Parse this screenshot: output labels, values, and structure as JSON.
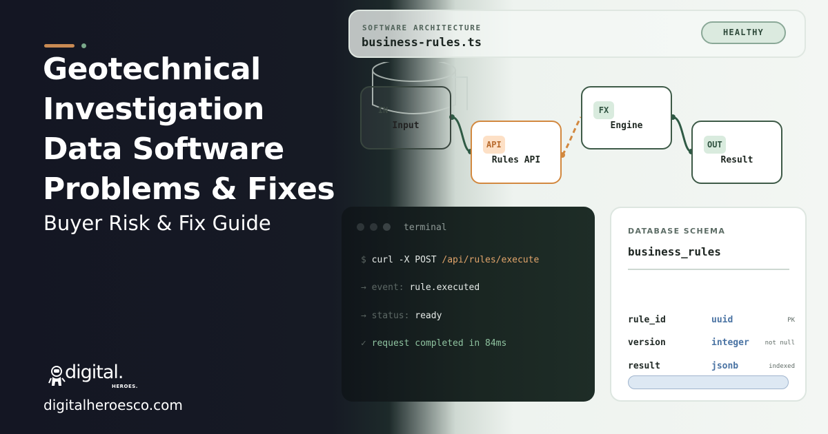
{
  "hero": {
    "title_lines": [
      "Geotechnical",
      "Investigation",
      "Data Software",
      "Problems & Fixes"
    ],
    "subtitle": "Buyer Risk & Fix Guide",
    "accent_color": "#c98a53"
  },
  "brand": {
    "logo_word": "digital.",
    "logo_sub": "HEROES.",
    "url": "digitalheroesco.com"
  },
  "header": {
    "eyebrow": "SOFTWARE ARCHITECTURE",
    "file": "business-rules.ts",
    "status": "HEALTHY"
  },
  "pipeline": {
    "nodes": [
      {
        "tag": "IN",
        "label": "Input"
      },
      {
        "tag": "API",
        "label": "Rules API"
      },
      {
        "tag": "FX",
        "label": "Engine"
      },
      {
        "tag": "OUT",
        "label": "Result"
      }
    ],
    "colors": {
      "connector": "#2f5a45",
      "api_accent": "#d2883f"
    }
  },
  "terminal": {
    "title": "terminal",
    "lines": [
      {
        "prefix": "$",
        "text": "curl -X POST",
        "highlight": "/api/rules/execute"
      },
      {
        "prefix": "→",
        "key": "event:",
        "value": "rule.executed"
      },
      {
        "prefix": "→",
        "key": "status:",
        "value": "ready"
      },
      {
        "prefix": "✓",
        "value": "request completed in 84ms"
      }
    ]
  },
  "schema": {
    "eyebrow": "DATABASE SCHEMA",
    "table": "business_rules",
    "rows": [
      {
        "name": "rule_id",
        "type": "uuid",
        "note": "PK"
      },
      {
        "name": "version",
        "type": "integer",
        "note": "not null"
      },
      {
        "name": "result",
        "type": "jsonb",
        "note": "indexed"
      }
    ]
  }
}
